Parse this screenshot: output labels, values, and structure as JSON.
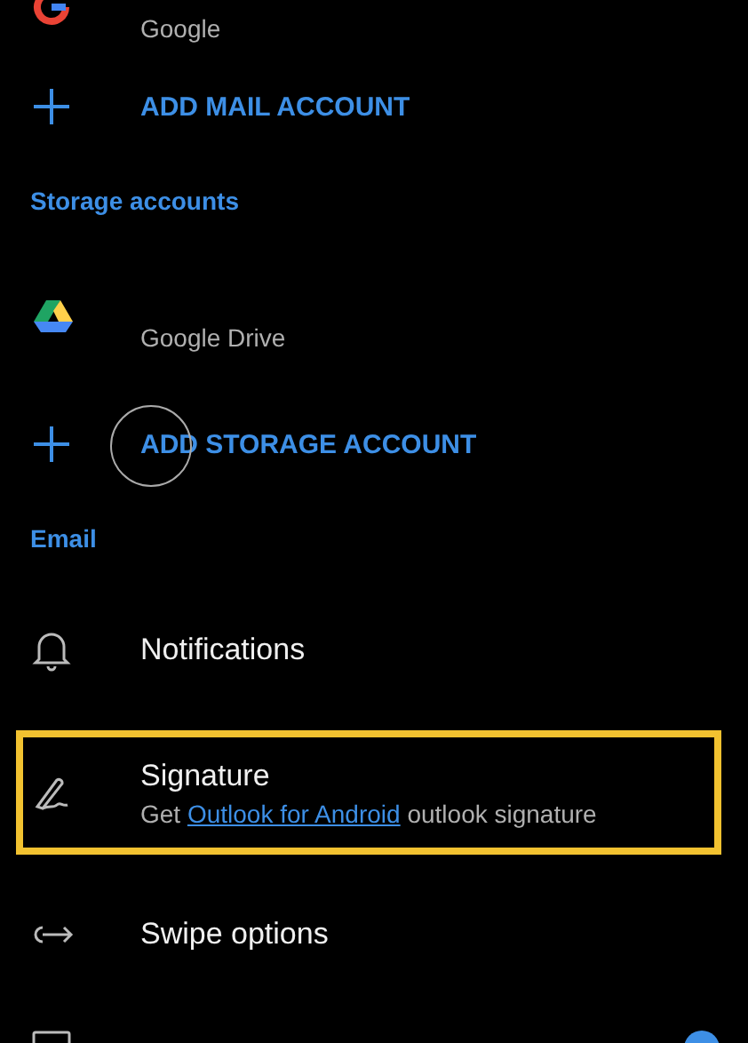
{
  "items": [
    {
      "kind": "account",
      "subtitle": "Google"
    },
    {
      "kind": "add",
      "label": "ADD MAIL ACCOUNT"
    },
    {
      "kind": "header",
      "label": "Storage accounts"
    },
    {
      "kind": "account",
      "subtitle": "Google Drive"
    },
    {
      "kind": "add",
      "label": "ADD STORAGE ACCOUNT",
      "touched": true
    },
    {
      "kind": "header",
      "label": "Email"
    },
    {
      "kind": "setting",
      "label": "Notifications",
      "highlighted": false
    },
    {
      "kind": "setting",
      "label": "Signature",
      "subtitle": [
        {
          "text": "Get"
        },
        {
          "text": "Outlook for Android",
          "kind": "link"
        },
        {
          "text": "outlook signature"
        }
      ],
      "highlighted": true
    },
    {
      "kind": "setting",
      "label": "Swipe options",
      "highlighted": false
    },
    {
      "kind": "partial",
      "on": true
    }
  ]
}
